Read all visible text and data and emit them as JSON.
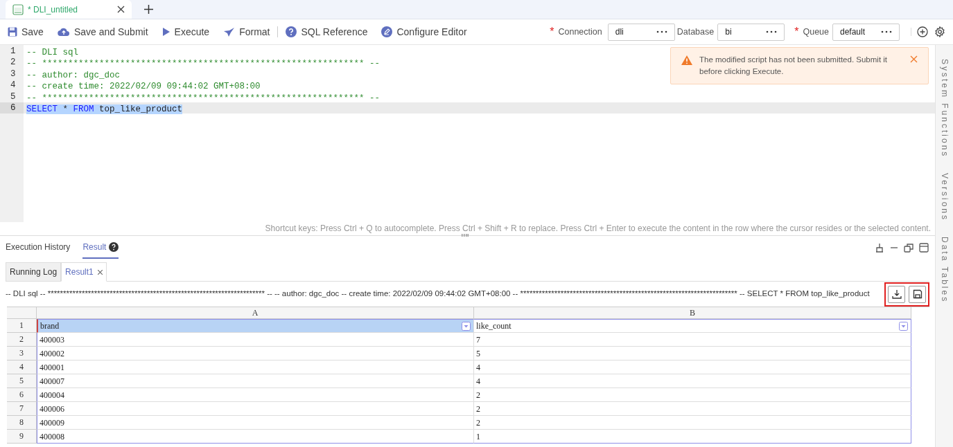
{
  "tabs": [
    {
      "label": "* DLI_untitled",
      "selected": true
    }
  ],
  "toolbar": {
    "buttons": [
      {
        "label": "Save",
        "kind": "save"
      },
      {
        "label": "Save and Submit",
        "kind": "upload"
      },
      {
        "label": "Execute",
        "kind": "play"
      },
      {
        "label": "Format",
        "kind": "format"
      },
      {
        "label": "SQL Reference",
        "kind": "help"
      },
      {
        "label": "Configure Editor",
        "kind": "edit"
      }
    ],
    "fields": [
      {
        "label": "Connection",
        "value": "dli",
        "required": true
      },
      {
        "label": "Database",
        "value": "bi",
        "required": false
      },
      {
        "label": "Queue",
        "value": "default",
        "required": true
      }
    ]
  },
  "editor": {
    "lines": [
      {
        "number": "1",
        "current": false,
        "tokens": [
          {
            "kind": "comment",
            "text": "-- DLI sql"
          }
        ]
      },
      {
        "number": "2",
        "current": false,
        "tokens": [
          {
            "kind": "comment",
            "text": "-- ************************************************************** --"
          }
        ]
      },
      {
        "number": "3",
        "current": false,
        "tokens": [
          {
            "kind": "comment",
            "text": "-- author: dgc_doc"
          }
        ]
      },
      {
        "number": "4",
        "current": false,
        "tokens": [
          {
            "kind": "comment",
            "text": "-- create time: 2022/02/09 09:44:02 GMT+08:00"
          }
        ]
      },
      {
        "number": "5",
        "current": false,
        "tokens": [
          {
            "kind": "comment",
            "text": "-- ************************************************************** --"
          }
        ]
      },
      {
        "number": "6",
        "current": true,
        "tokens": [
          {
            "kind": "keyword",
            "text": "SELECT"
          },
          {
            "kind": "plain",
            "text": " * "
          },
          {
            "kind": "keyword",
            "text": "FROM"
          },
          {
            "kind": "plain",
            "text": " top_like_product"
          }
        ]
      }
    ],
    "hint": "Shortcut keys: Press Ctrl + Q to autocomplete. Press Ctrl + Shift + R to replace. Press Ctrl + Enter to execute the content in the row where the cursor resides or the selected content."
  },
  "notification": {
    "text": "The modified script has not been submitted. Submit it before clicking Execute."
  },
  "side_panel": [
    "System Functions",
    "Versions",
    "Data Tables"
  ],
  "bottom_tabs": [
    {
      "label": "Execution History",
      "selected": false
    },
    {
      "label": "Result",
      "selected": true
    }
  ],
  "result_tabs": [
    {
      "label": "Running Log",
      "selected": false,
      "closable": false
    },
    {
      "label": "Result1",
      "selected": true,
      "closable": true
    }
  ],
  "query_summary": "-- DLI sql -- ********************************************************************** -- -- author: dgc_doc -- create time: 2022/02/09 09:44:02 GMT+08:00 -- ********************************************************************** -- SELECT * FROM top_like_product",
  "table": {
    "columns": [
      "A",
      "B"
    ],
    "rows": [
      {
        "number": "1",
        "kind": "header",
        "cells": [
          {
            "text": "brand",
            "selected": true
          },
          {
            "text": "like_count",
            "selected": false
          }
        ]
      },
      {
        "number": "2",
        "kind": "data",
        "cells": [
          {
            "text": "400003",
            "selected": false
          },
          {
            "text": "7",
            "selected": false
          }
        ]
      },
      {
        "number": "3",
        "kind": "data",
        "cells": [
          {
            "text": "400002",
            "selected": false
          },
          {
            "text": "5",
            "selected": false
          }
        ]
      },
      {
        "number": "4",
        "kind": "data",
        "cells": [
          {
            "text": "400001",
            "selected": false
          },
          {
            "text": "4",
            "selected": false
          }
        ]
      },
      {
        "number": "5",
        "kind": "data",
        "cells": [
          {
            "text": "400007",
            "selected": false
          },
          {
            "text": "4",
            "selected": false
          }
        ]
      },
      {
        "number": "6",
        "kind": "data",
        "cells": [
          {
            "text": "400004",
            "selected": false
          },
          {
            "text": "2",
            "selected": false
          }
        ]
      },
      {
        "number": "7",
        "kind": "data",
        "cells": [
          {
            "text": "400006",
            "selected": false
          },
          {
            "text": "2",
            "selected": false
          }
        ]
      },
      {
        "number": "8",
        "kind": "data",
        "cells": [
          {
            "text": "400009",
            "selected": false
          },
          {
            "text": "2",
            "selected": false
          }
        ]
      },
      {
        "number": "9",
        "kind": "data",
        "cells": [
          {
            "text": "400008",
            "selected": false
          },
          {
            "text": "1",
            "selected": false
          }
        ]
      }
    ]
  }
}
